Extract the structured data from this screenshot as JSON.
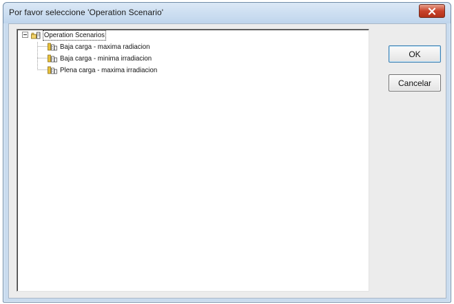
{
  "window": {
    "title": "Por favor seleccione 'Operation Scenario'"
  },
  "tree": {
    "root": {
      "label": "Operation Scenarios",
      "expanded": true,
      "icon": "folder-building-icon"
    },
    "children": [
      {
        "label": "Baja carga - maxima radiacion",
        "icon": "scenario-icon"
      },
      {
        "label": "Baja carga - minima irradiacion",
        "icon": "scenario-icon"
      },
      {
        "label": "Plena carga - maxima irradiacion",
        "icon": "scenario-icon"
      }
    ]
  },
  "buttons": {
    "ok_label": "OK",
    "cancel_label": "Cancelar"
  },
  "colors": {
    "title_bar": "#c9dbee",
    "close_button": "#c8432b",
    "client_bg": "#ececec"
  }
}
